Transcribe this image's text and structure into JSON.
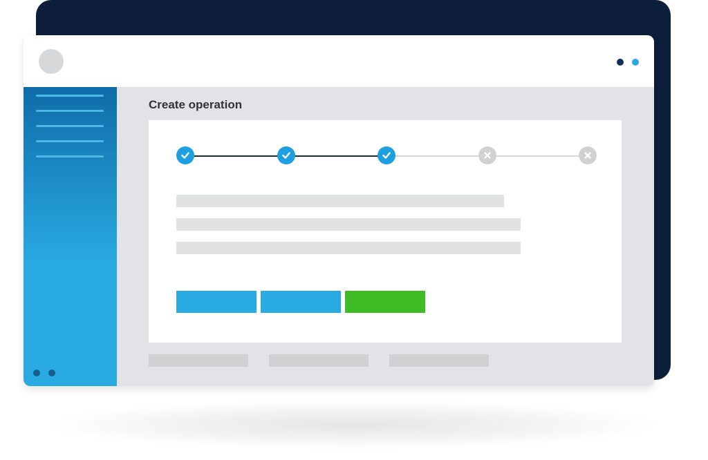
{
  "page": {
    "title": "Create operation"
  },
  "colors": {
    "accent_blue": "#29abe2",
    "accent_dark_blue": "#0d315d",
    "action_green": "#3fbb26",
    "backdrop": "#0c1e3a"
  },
  "stepper": {
    "steps": [
      {
        "state": "done"
      },
      {
        "state": "done"
      },
      {
        "state": "done"
      },
      {
        "state": "pending"
      },
      {
        "state": "pending"
      }
    ],
    "completed_count": 3,
    "total": 5
  }
}
